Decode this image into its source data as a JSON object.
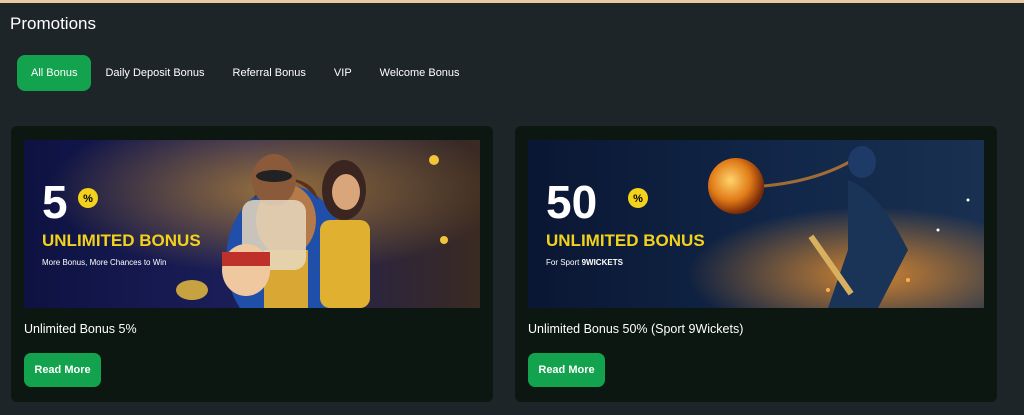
{
  "page": {
    "title": "Promotions"
  },
  "tabs": [
    {
      "label": "All Bonus",
      "active": true
    },
    {
      "label": "Daily Deposit Bonus",
      "active": false
    },
    {
      "label": "Referral Bonus",
      "active": false
    },
    {
      "label": "VIP",
      "active": false
    },
    {
      "label": "Welcome Bonus",
      "active": false
    }
  ],
  "colors": {
    "accent": "#13a24d",
    "background": "#1e2528",
    "card": "#0c1712",
    "bonus_text": "#f2d21b"
  },
  "promotions": [
    {
      "title": "Unlimited Bonus 5%",
      "button": "Read More",
      "banner": {
        "number": "5",
        "percent": "%",
        "headline": "UNLIMITED BONUS",
        "subline": "More Bonus, More Chances to Win"
      }
    },
    {
      "title": "Unlimited Bonus 50% (Sport 9Wickets)",
      "button": "Read More",
      "banner": {
        "number": "50",
        "percent": "%",
        "headline": "UNLIMITED BONUS",
        "subline_prefix": "For Sport",
        "subline_brand": "9WICKETS"
      }
    }
  ]
}
